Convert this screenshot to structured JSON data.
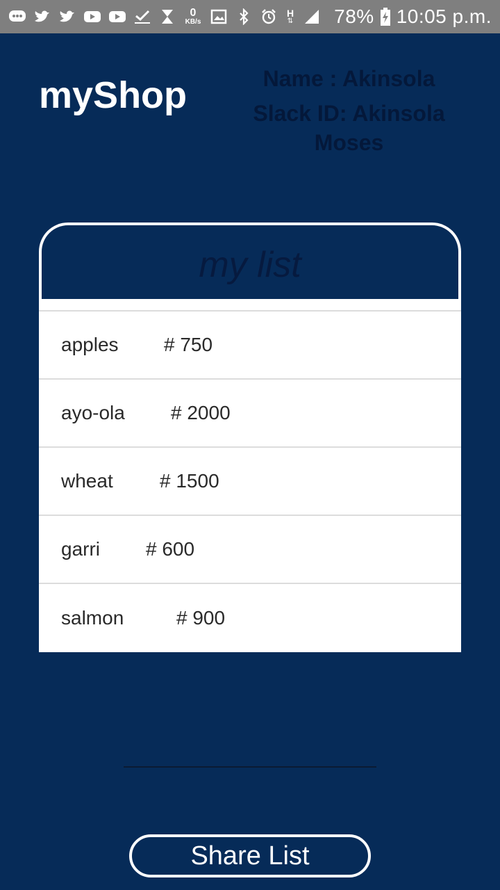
{
  "status_bar": {
    "icons": [
      "messages-icon",
      "twitter-icon",
      "twitter-icon",
      "youtube-icon",
      "youtube-icon",
      "download-done-icon",
      "hourglass-icon",
      "data-speed-icon",
      "gallery-icon",
      "bluetooth-icon",
      "alarm-icon",
      "network-h-icon",
      "signal-icon"
    ],
    "data_speed_value": "0",
    "data_speed_unit": "KB/s",
    "network_type": "H",
    "battery": "78%",
    "time": "10:05 p.m."
  },
  "app": {
    "title": "myShop",
    "name_line": "Name : Akinsola",
    "slack_line": "Slack ID: Akinsola Moses"
  },
  "list": {
    "header": "my list",
    "items": [
      {
        "name": "apples",
        "price": "# 750"
      },
      {
        "name": "ayo-ola",
        "price": "# 2000"
      },
      {
        "name": "wheat",
        "price": "# 1500"
      },
      {
        "name": "garri",
        "price": "# 600"
      },
      {
        "name": "salmon",
        "price": "# 900"
      }
    ]
  },
  "share_button": {
    "label": "Share List"
  },
  "colors": {
    "background": "#062b58",
    "status_bar": "#7f7f7f",
    "title_text": "#ffffff",
    "info_text": "#04183a",
    "list_bg": "#ffffff"
  }
}
